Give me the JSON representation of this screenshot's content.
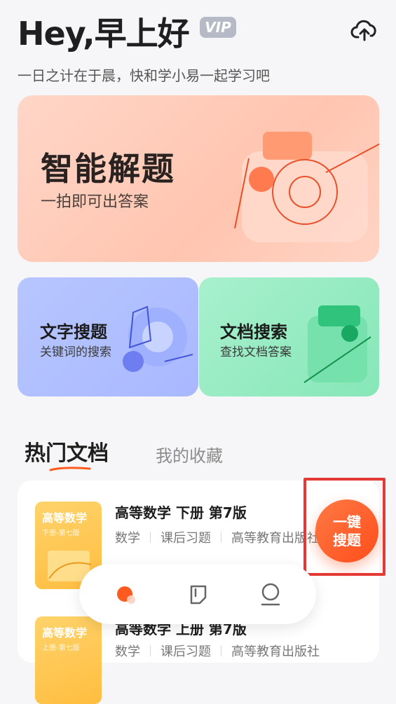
{
  "header": {
    "greeting": "Hey,早上好",
    "vip_badge": "VIP",
    "subtitle": "一日之计在于晨，快和学小易一起学习吧",
    "upload_icon": "cloud-upload-icon"
  },
  "hero": {
    "title": "智能解题",
    "subtitle": "一拍即可出答案"
  },
  "cards": [
    {
      "title": "文字搜题",
      "subtitle": "关键词的搜索",
      "color": "#aebcff"
    },
    {
      "title": "文档搜索",
      "subtitle": "查找文档答案",
      "color": "#95ebc1"
    }
  ],
  "tabs": {
    "active": "热门文档",
    "inactive": "我的收藏"
  },
  "documents": [
    {
      "thumb_title": "高等数学",
      "thumb_sub": "下册-第七版",
      "title": "高等数学 下册 第7版",
      "meta": [
        "数学",
        "课后习题",
        "高等教育出版社"
      ]
    },
    {
      "thumb_title": "高等数学",
      "thumb_sub": "上册-第七版",
      "title": "高等数学 上册 第7版",
      "meta": [
        "数学",
        "课后习题",
        "高等教育出版社"
      ]
    }
  ],
  "fab": {
    "line1": "一键",
    "line2": "搜题"
  },
  "nav": {
    "items": [
      "home-icon",
      "notes-icon",
      "profile-icon"
    ],
    "accent": "#ff5a1f"
  }
}
